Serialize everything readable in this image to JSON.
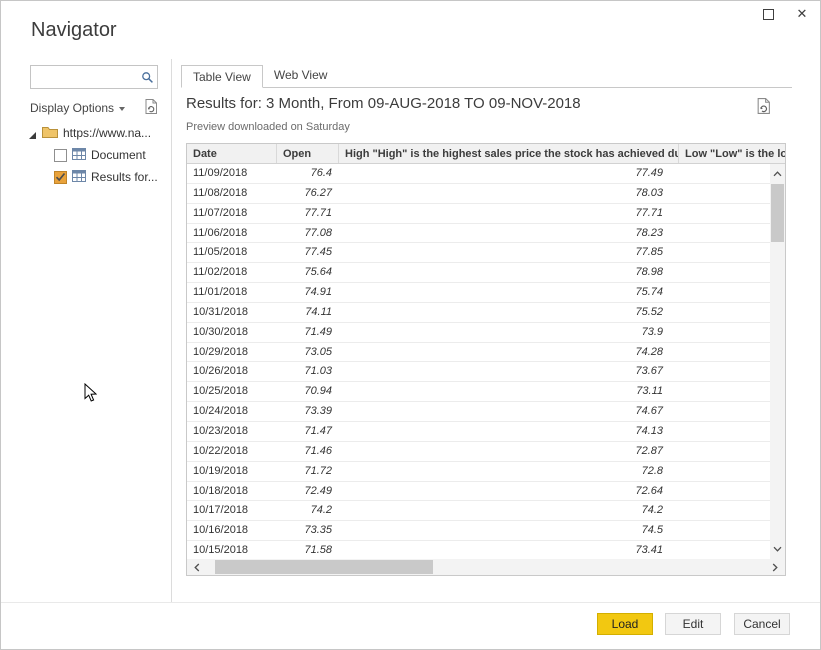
{
  "window": {
    "title": "Navigator"
  },
  "sidebar": {
    "search": {
      "value": "",
      "placeholder": ""
    },
    "display_options_label": "Display Options",
    "tree": {
      "root_label": "https://www.na...",
      "items": [
        {
          "label": "Document",
          "checked": false
        },
        {
          "label": "Results for...",
          "checked": true
        }
      ]
    }
  },
  "main": {
    "tabs": [
      {
        "label": "Table View"
      },
      {
        "label": "Web View"
      }
    ],
    "title": "Results for: 3 Month, From 09-AUG-2018 TO 09-NOV-2018",
    "subtitle": "Preview downloaded on Saturday",
    "table": {
      "columns": [
        "Date",
        "Open",
        "High \"High\" is the highest sales price the stock has achieved during th...",
        "Low \"Low\" is the lowes"
      ],
      "rows": [
        {
          "date": "11/09/2018",
          "open": "76.4",
          "high": "77.49"
        },
        {
          "date": "11/08/2018",
          "open": "76.27",
          "high": "78.03"
        },
        {
          "date": "11/07/2018",
          "open": "77.71",
          "high": "77.71"
        },
        {
          "date": "11/06/2018",
          "open": "77.08",
          "high": "78.23"
        },
        {
          "date": "11/05/2018",
          "open": "77.45",
          "high": "77.85"
        },
        {
          "date": "11/02/2018",
          "open": "75.64",
          "high": "78.98"
        },
        {
          "date": "11/01/2018",
          "open": "74.91",
          "high": "75.74"
        },
        {
          "date": "10/31/2018",
          "open": "74.11",
          "high": "75.52"
        },
        {
          "date": "10/30/2018",
          "open": "71.49",
          "high": "73.9"
        },
        {
          "date": "10/29/2018",
          "open": "73.05",
          "high": "74.28"
        },
        {
          "date": "10/26/2018",
          "open": "71.03",
          "high": "73.67"
        },
        {
          "date": "10/25/2018",
          "open": "70.94",
          "high": "73.11"
        },
        {
          "date": "10/24/2018",
          "open": "73.39",
          "high": "74.67"
        },
        {
          "date": "10/23/2018",
          "open": "71.47",
          "high": "74.13"
        },
        {
          "date": "10/22/2018",
          "open": "71.46",
          "high": "72.87"
        },
        {
          "date": "10/19/2018",
          "open": "71.72",
          "high": "72.8"
        },
        {
          "date": "10/18/2018",
          "open": "72.49",
          "high": "72.64"
        },
        {
          "date": "10/17/2018",
          "open": "74.2",
          "high": "74.2"
        },
        {
          "date": "10/16/2018",
          "open": "73.35",
          "high": "74.5"
        },
        {
          "date": "10/15/2018",
          "open": "71.58",
          "high": "73.41"
        }
      ]
    }
  },
  "footer": {
    "load": "Load",
    "edit": "Edit",
    "cancel": "Cancel"
  },
  "colors": {
    "load_button": "#F2C811",
    "checkbox_checked": "#E9A23B"
  }
}
